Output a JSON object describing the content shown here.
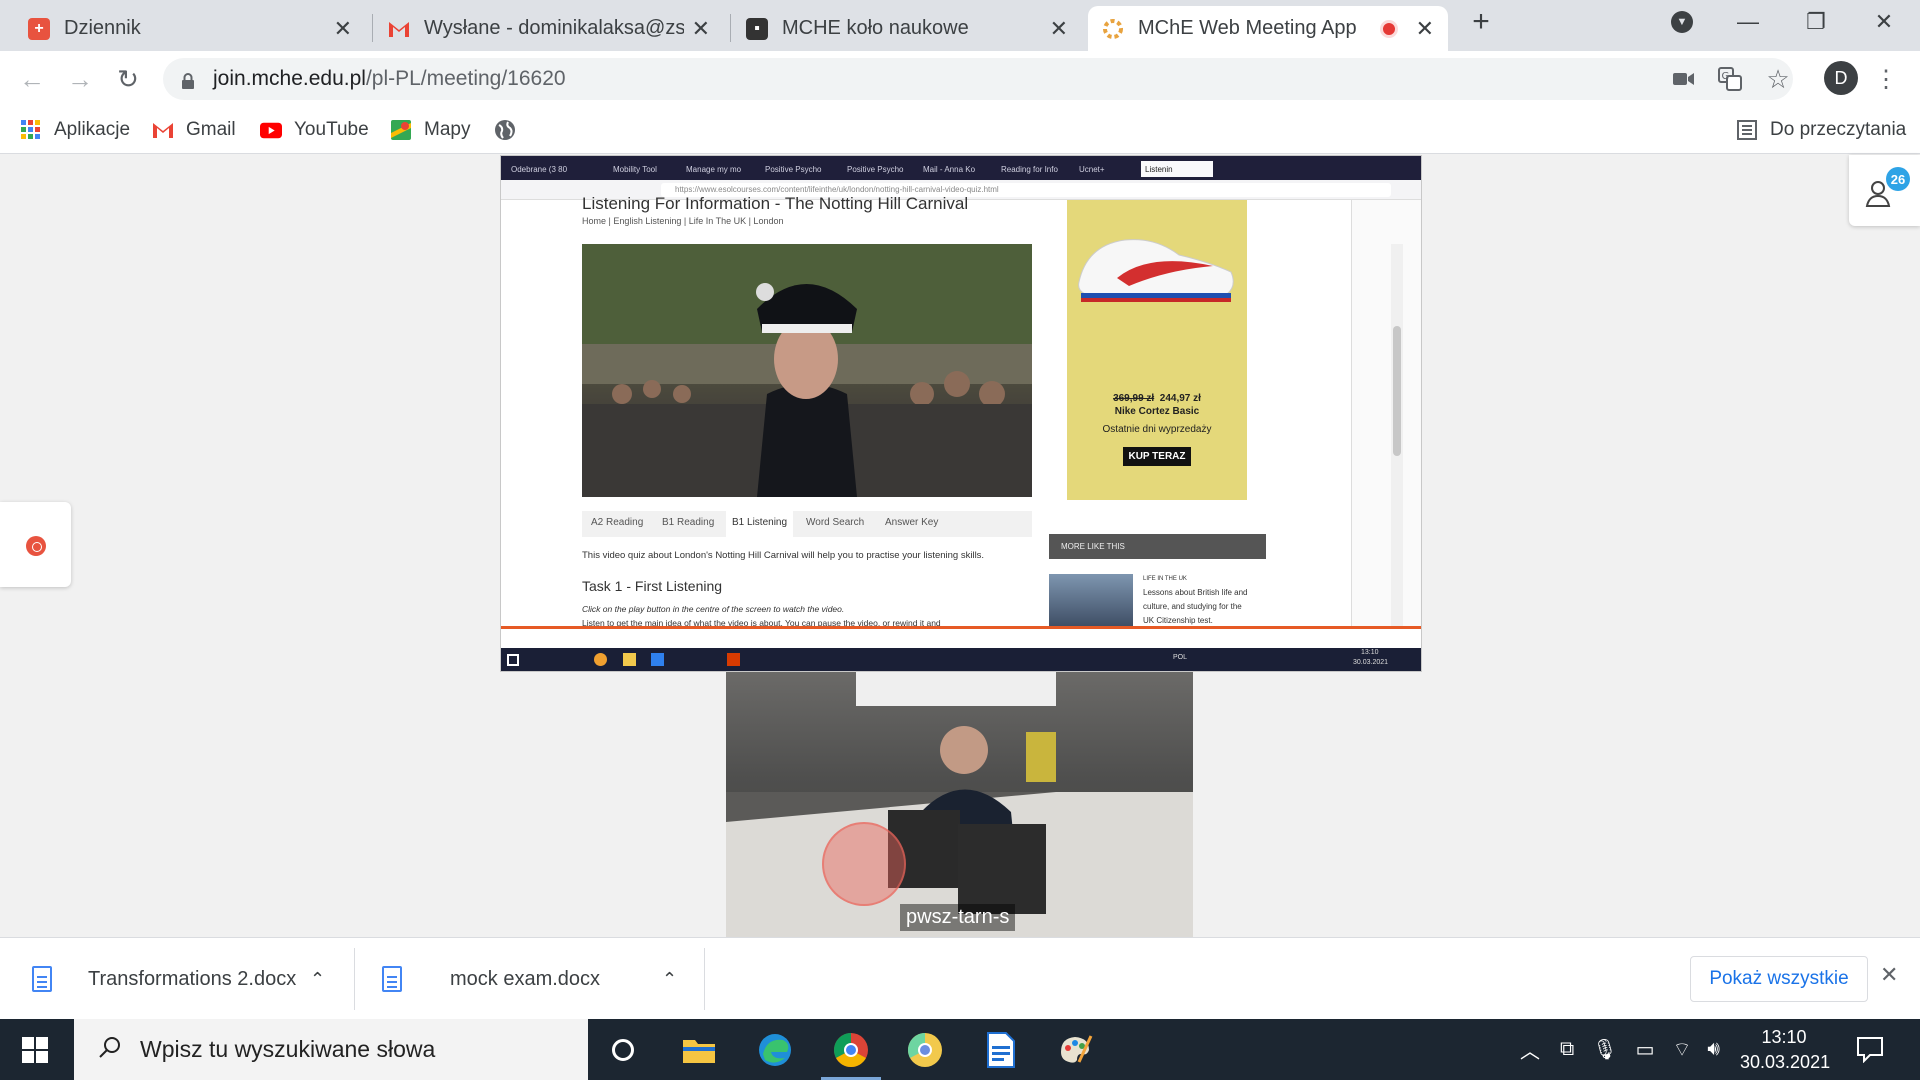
{
  "browser": {
    "tabs": [
      {
        "title": "Dziennik",
        "icon": "dziennik-icon",
        "color": "#e8533f"
      },
      {
        "title": "Wysłane - dominikalaksa@zswolbrom",
        "icon": "gmail-icon",
        "color": "#ea4335"
      },
      {
        "title": "MCHE koło naukowe",
        "icon": "contact-card-icon",
        "color": "#333333"
      },
      {
        "title": "MChE Web Meeting App",
        "icon": "mche-icon",
        "color": "#e8a33f",
        "recording": true
      }
    ],
    "new_tab": "+",
    "url_host": "join.mche.edu.pl",
    "url_path": "/pl-PL/meeting/16620",
    "profile_initial": "D",
    "bookmarks": [
      {
        "label": "Aplikacje",
        "icon": "apps-grid-icon"
      },
      {
        "label": "Gmail",
        "icon": "gmail-icon"
      },
      {
        "label": "YouTube",
        "icon": "youtube-icon"
      },
      {
        "label": "Mapy",
        "icon": "maps-icon"
      },
      {
        "label": "",
        "icon": "globe-icon"
      }
    ],
    "reading_list": "Do przeczytania"
  },
  "meeting": {
    "participants_count": "26",
    "webcam_name": "pwsz-tarn-s",
    "shared_screen": {
      "tabs": [
        "Odebrane (3 80",
        "Mobility Tool",
        "Manage my mo",
        "Positive Psycho",
        "Positive Psycho",
        "Mail - Anna Ko",
        "Reading for Info",
        "Ucnet+",
        "Listenin"
      ],
      "url": "https://www.esolcourses.com/content/lifeinthe/uk/london/notting-hill-carnival-video-quiz.html",
      "page_title": "Listening For Information - The Notting Hill Carnival",
      "breadcrumb": "Home | English Listening | Life In The UK | London",
      "lesson_tabs": [
        "A2 Reading",
        "B1 Reading",
        "B1 Listening",
        "Word Search",
        "Answer Key"
      ],
      "intro": "This video quiz about London's Notting Hill Carnival will help you to practise your listening skills.",
      "task_heading": "Task 1 - First Listening",
      "task_instruction": "Click on the play button in the centre of the screen to watch the video.",
      "task_text": "Listen to get the main idea of what the video is about. You can pause the video, or rewind it and",
      "ad": {
        "old_price": "369,99 zł",
        "new_price": "244,97 zł",
        "product": "Nike Cortez Basic",
        "subtitle": "Ostatnie dni wyprzedaży",
        "cta": "KUP TERAZ"
      },
      "more_like_this": "MORE LIKE THIS",
      "related_label": "LIFE IN THE UK",
      "related_text": "Lessons about British life and culture, and studying for the UK Citizenship test.",
      "taskbar_lang": "POL",
      "taskbar_time": "13:10",
      "taskbar_date": "30.03.2021"
    }
  },
  "downloads": {
    "items": [
      "Transformations 2.docx",
      "mock exam.docx"
    ],
    "show_all": "Pokaż wszystkie"
  },
  "taskbar": {
    "search_placeholder": "Wpisz tu wyszukiwane słowa",
    "time": "13:10",
    "date": "30.03.2021"
  }
}
